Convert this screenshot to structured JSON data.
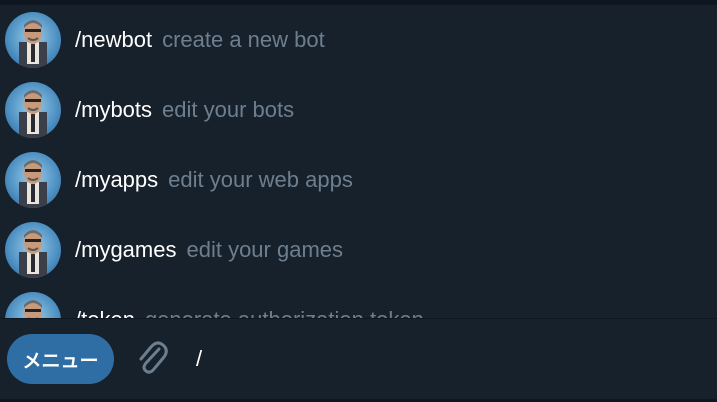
{
  "commands": [
    {
      "name": "/newbot",
      "description": "create a new bot"
    },
    {
      "name": "/mybots",
      "description": "edit your bots"
    },
    {
      "name": "/myapps",
      "description": "edit your web apps"
    },
    {
      "name": "/mygames",
      "description": "edit your games"
    },
    {
      "name": "/token",
      "description": "generate authorization token"
    }
  ],
  "composer": {
    "menu_label": "メニュー",
    "input_value": "/",
    "attach_icon": "paperclip-icon"
  },
  "colors": {
    "background": "#17212b",
    "menu_button": "#2f6ea5",
    "command_name": "#ffffff",
    "command_description": "#6d7f8f"
  }
}
